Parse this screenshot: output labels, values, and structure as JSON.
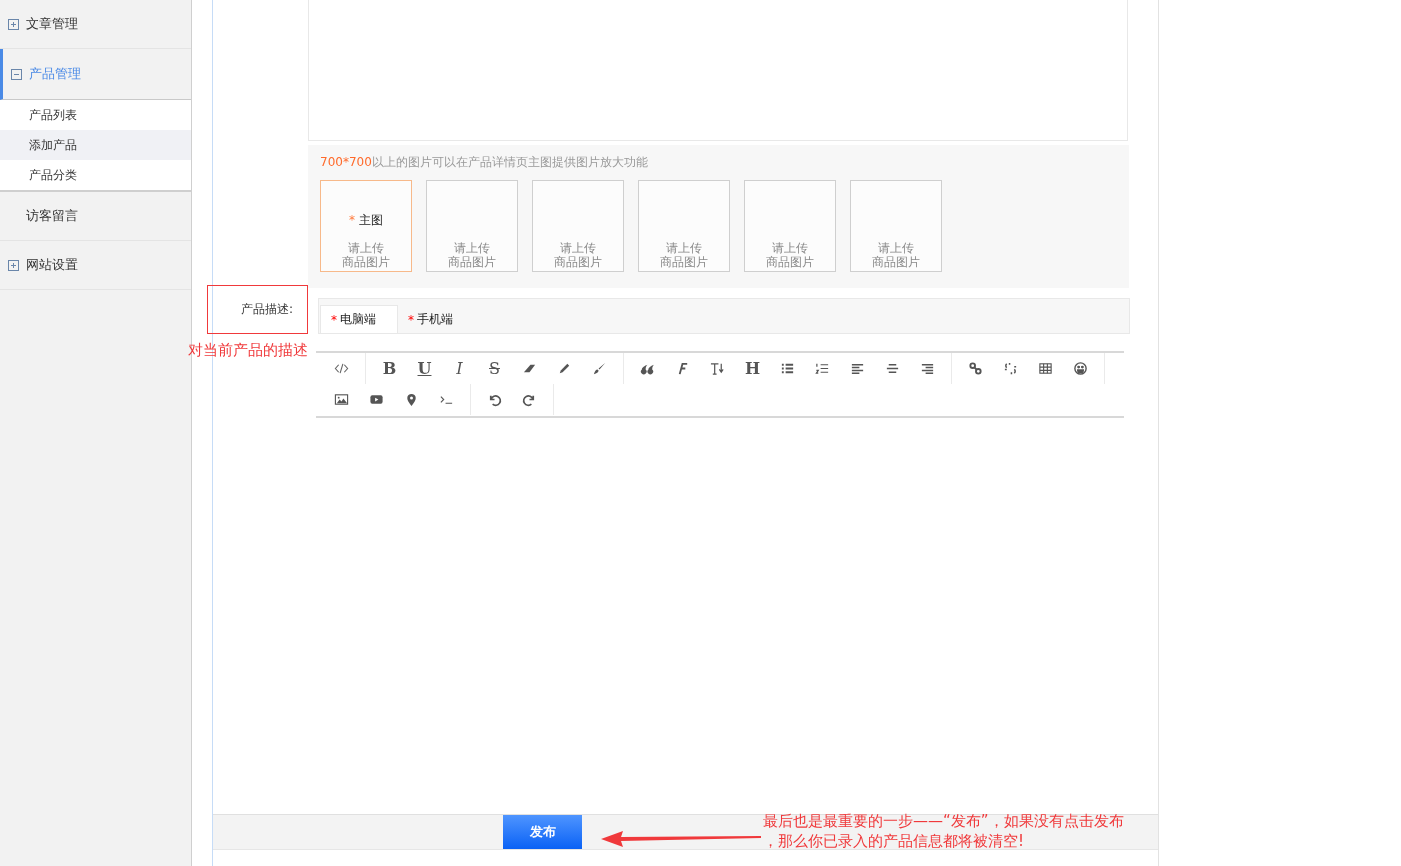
{
  "sidebar": [
    {
      "label": "文章管理",
      "expanded": false,
      "selected": false
    },
    {
      "label": "产品管理",
      "expanded": true,
      "selected": true,
      "children": [
        {
          "label": "产品列表",
          "selected": false
        },
        {
          "label": "添加产品",
          "selected": true
        },
        {
          "label": "产品分类",
          "selected": false
        }
      ]
    },
    {
      "label": "访客留言",
      "selected": false
    },
    {
      "label": "网站设置",
      "expanded": false,
      "selected": false
    }
  ],
  "images": {
    "hint_highlight": "700*700",
    "hint": "以上的图片可以在产品详情页主图提供图片放大功能",
    "slots": [
      {
        "mark": "*",
        "title": "主图",
        "line1": "请上传",
        "line2": "商品图片",
        "selected": true
      },
      {
        "line1": "请上传",
        "line2": "商品图片",
        "selected": false
      },
      {
        "line1": "请上传",
        "line2": "商品图片",
        "selected": false
      },
      {
        "line1": "请上传",
        "line2": "商品图片",
        "selected": false
      },
      {
        "line1": "请上传",
        "line2": "商品图片",
        "selected": false
      },
      {
        "line1": "请上传",
        "line2": "商品图片",
        "selected": false
      }
    ]
  },
  "description": {
    "label": "产品描述:",
    "annotation": "对当前产品的描述",
    "tabs": [
      {
        "mark": "*",
        "label": "电脑端",
        "selected": true
      },
      {
        "mark": "*",
        "label": "手机端",
        "selected": false
      }
    ],
    "toolbar_glyphs": [
      "B",
      "U",
      "I",
      "S",
      "H"
    ]
  },
  "publish": {
    "button": "发布",
    "annotation_line1": "最后也是最重要的一步——“发布”，如果没有点击发布",
    "annotation_line2": "，那么你已录入的产品信息都将被清空!"
  }
}
